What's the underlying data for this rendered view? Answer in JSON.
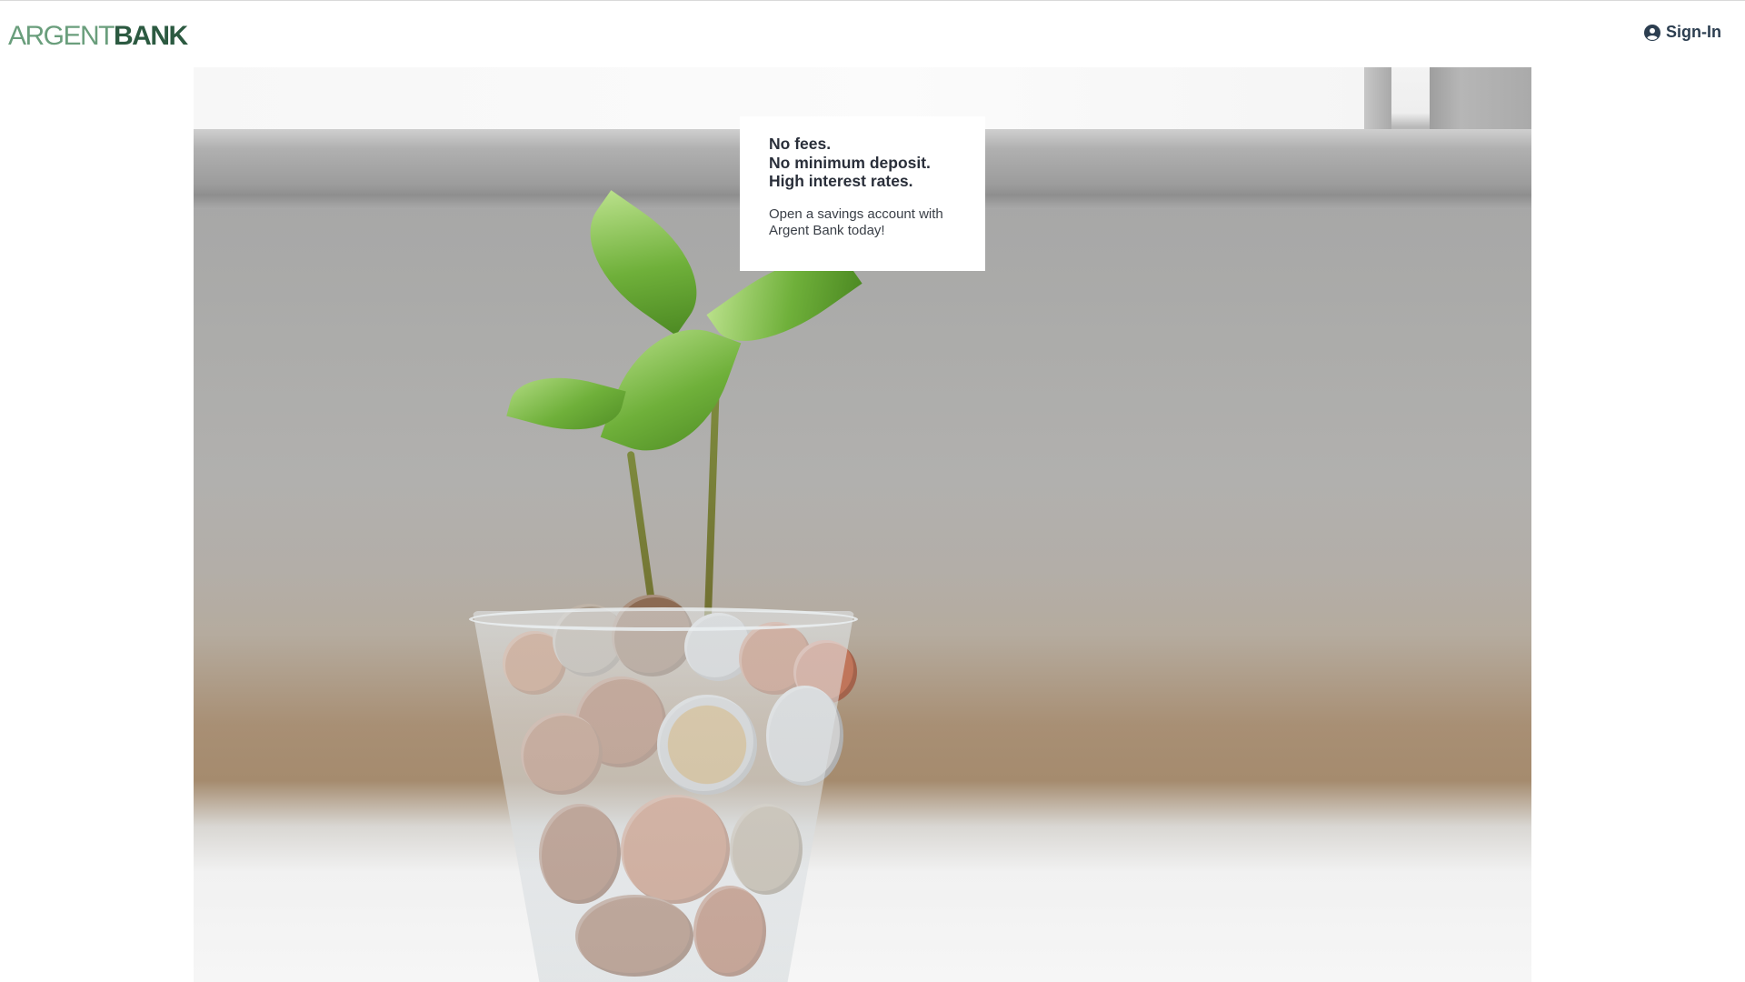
{
  "header": {
    "logo_part1": "ARGENT",
    "logo_part2": "BANK",
    "signin_label": "Sign-In",
    "signin_icon": "user-circle-icon"
  },
  "hero": {
    "image_description_icon": "plant-coins-photo"
  },
  "promo": {
    "headline_line1": "No fees.",
    "headline_line2": "No minimum deposit.",
    "headline_line3": "High interest rates.",
    "body": "Open a savings account with Argent Bank today!"
  },
  "colors": {
    "brand_light": "#6a9e7c",
    "brand_dark": "#2c5a41",
    "text_dark": "#2c3e50"
  }
}
